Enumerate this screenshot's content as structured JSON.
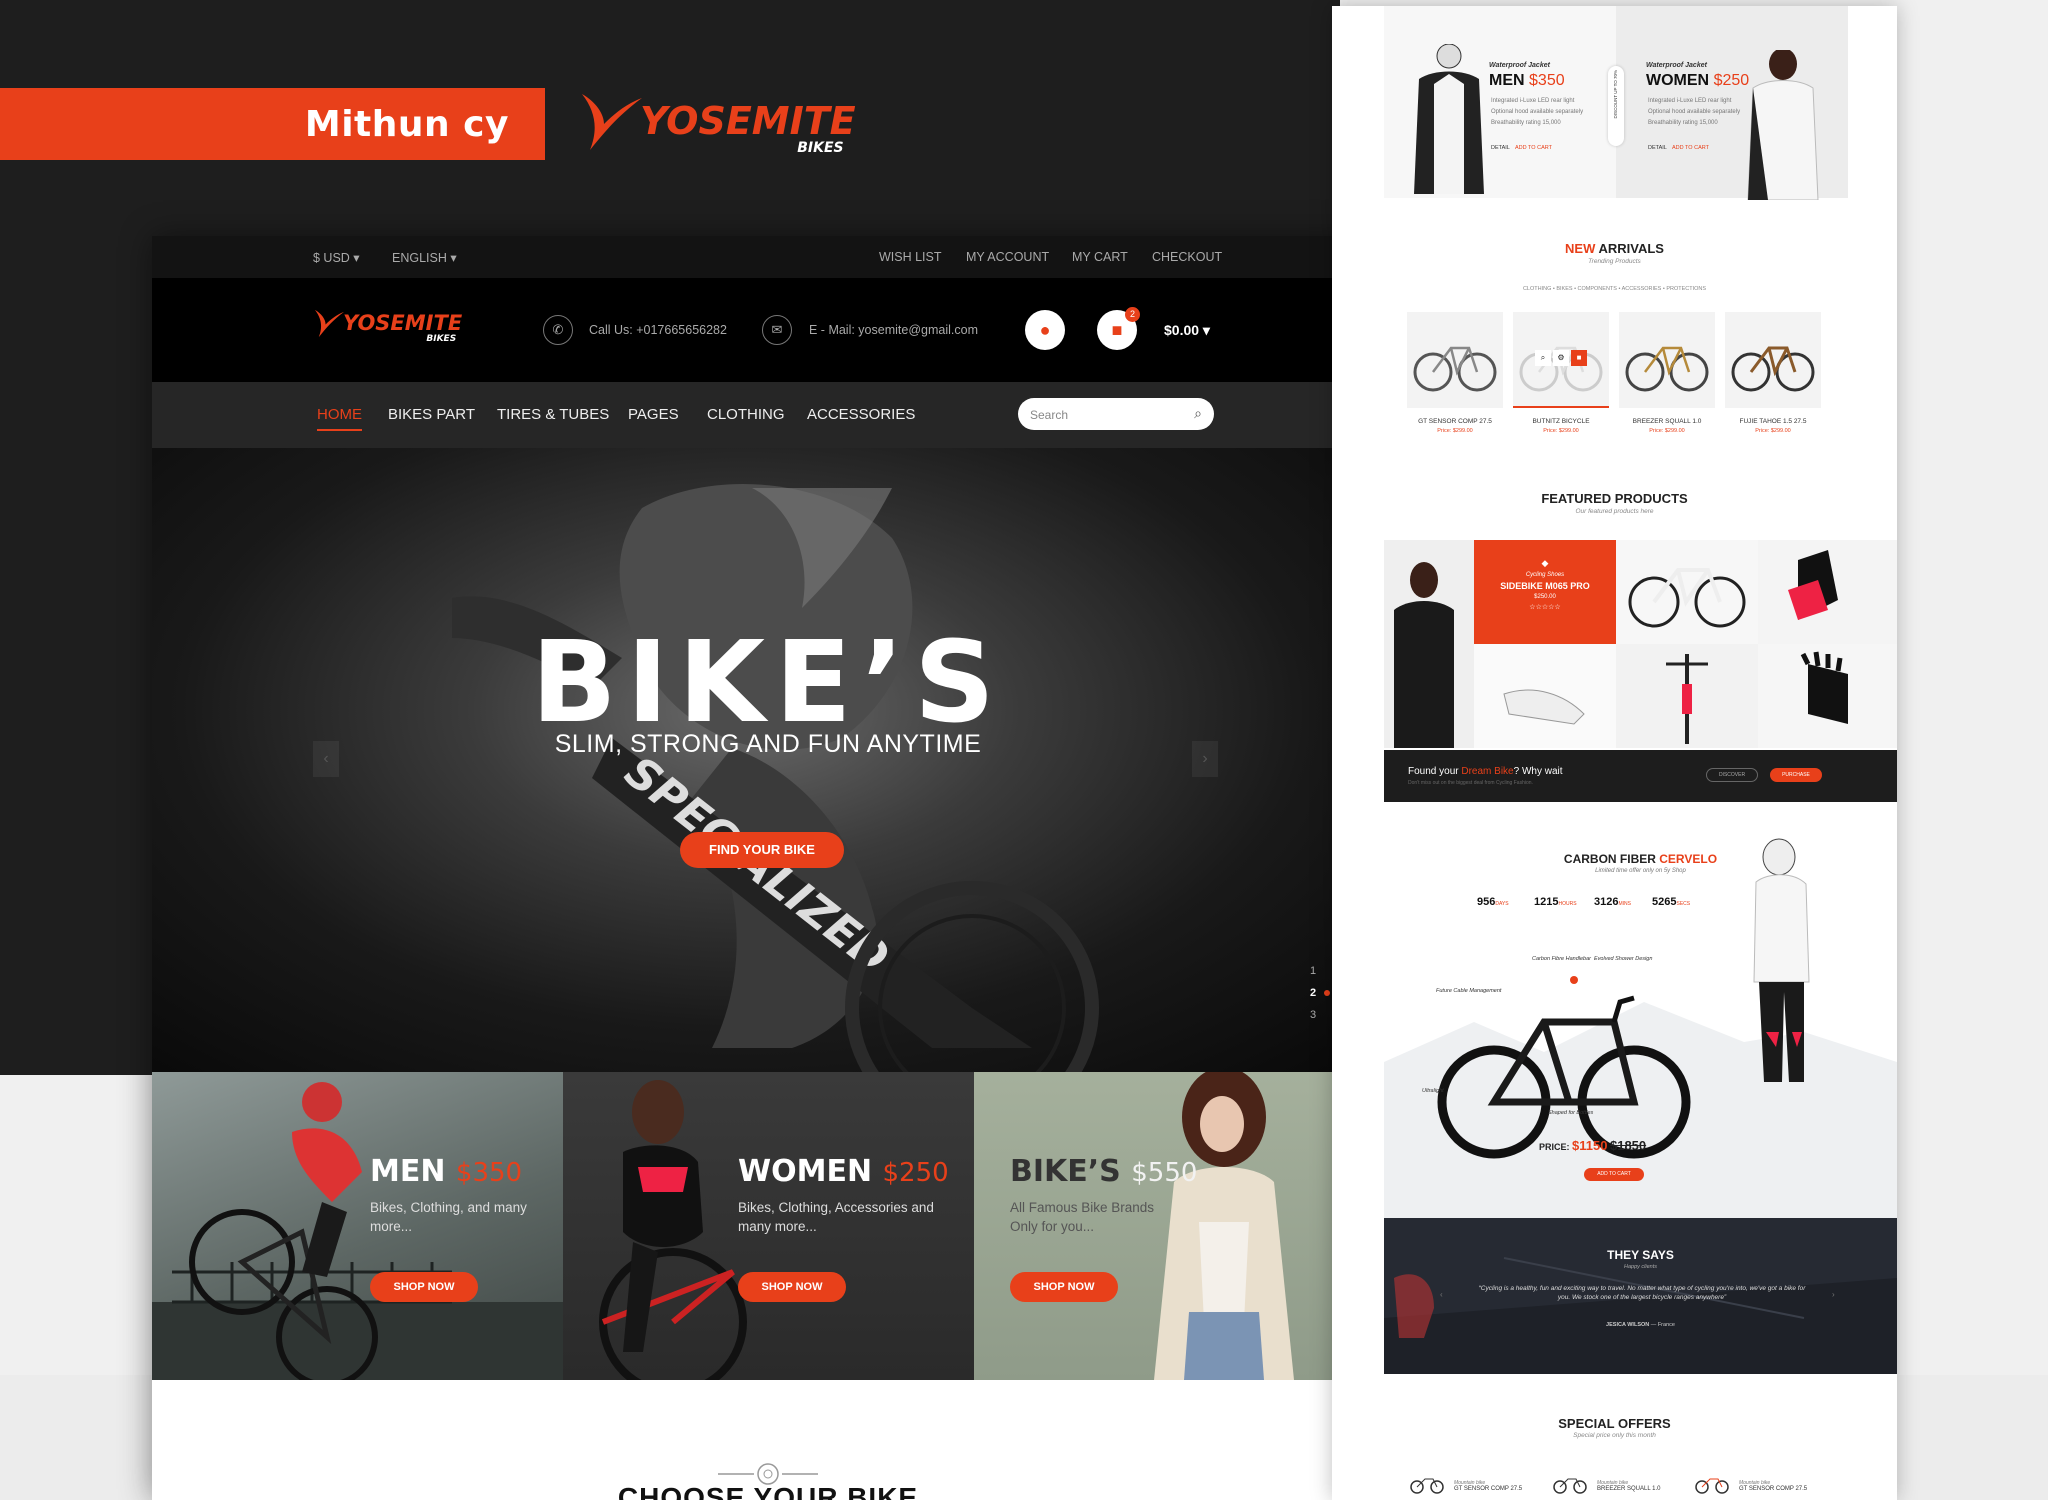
{
  "author": "Mithun cy",
  "brand": {
    "name": "YOSEMITE",
    "sub": "BIKES"
  },
  "topbar": {
    "currency": "$ USD",
    "language": "ENGLISH",
    "links": [
      "WISH LIST",
      "MY ACCOUNT",
      "MY CART",
      "CHECKOUT"
    ]
  },
  "header": {
    "phone": "Call Us: +017665656282",
    "email": "E - Mail: yosemite@gmail.com",
    "cart_count": "2",
    "cart_total": "$0.00"
  },
  "nav": {
    "items": [
      "HOME",
      "BIKES PART",
      "TIRES & TUBES",
      "PAGES",
      "CLOTHING",
      "ACCESSORIES"
    ],
    "active": "HOME",
    "search_placeholder": "Search"
  },
  "hero": {
    "title": "BIKE’S",
    "subtitle": "SLIM, STRONG AND FUN ANYTIME",
    "button": "FIND YOUR BIKE",
    "slides": [
      "1",
      "2",
      "3"
    ],
    "active_slide": "2"
  },
  "promos": [
    {
      "title": "MEN",
      "price": "$350",
      "desc": "Bikes, Clothing, and many more...",
      "button": "SHOP NOW"
    },
    {
      "title": "WOMEN",
      "price": "$250",
      "desc": "Bikes, Clothing, Accessories and many more...",
      "button": "SHOP NOW"
    },
    {
      "title": "BIKE’S",
      "price": "$550",
      "desc": "All Famous Bike Brands Only for you...",
      "button": "SHOP NOW"
    }
  ],
  "choose_title": "CHOOSE YOUR BIKE",
  "right": {
    "jackets": [
      {
        "label": "Waterproof Jacket",
        "title": "MEN",
        "price": "$350",
        "lines": [
          "Integrated i-Luxe LED rear light",
          "Optional hood available separately",
          "Breathability rating 15,000"
        ],
        "detail": "DETAIL",
        "add": "ADD TO CART"
      },
      {
        "label": "Waterproof Jacket",
        "title": "WOMEN",
        "price": "$250",
        "lines": [
          "Integrated i-Luxe LED rear light",
          "Optional hood available separately",
          "Breathability rating 15,000"
        ],
        "detail": "DETAIL",
        "add": "ADD TO CART"
      }
    ],
    "discount": "DISCOUNT UP TO 70%",
    "new_arrivals": {
      "title": "NEW ARRIVALS",
      "sub": "Trending Products",
      "filters": "CLOTHING • BIKES • COMPONENTS • ACCESSORIES • PROTECTIONS",
      "products": [
        {
          "name": "GT SENSOR COMP 27.5",
          "price": "Price: $299.00"
        },
        {
          "name": "BUTNITZ BICYCLE",
          "price": "Price: $299.00"
        },
        {
          "name": "BREEZER SQUALL 1.0",
          "price": "Price: $299.00"
        },
        {
          "name": "FUJIE TAHOE 1.5 27.5",
          "price": "Price: $299.00"
        }
      ]
    },
    "featured": {
      "title": "FEATURED PRODUCTS",
      "sub": "Our featured products here",
      "card_label": "Cycling Shoes",
      "card_name": "SIDEBIKE M065 PRO",
      "card_price": "$250.00",
      "stars": "☆☆☆☆☆"
    },
    "dream": {
      "text_pre": "Found your ",
      "highlight": "Dream Bike",
      "text_post": "? Why wait",
      "sub": "Don't miss out on the biggest deal from Cycling Fashion.",
      "discover": "DISCOVER",
      "purchase": "PURCHASE"
    },
    "carbon": {
      "title": "CARBON FIBER",
      "highlight": "CERVELO",
      "sub": "Limited time offer only on 5y Shop",
      "stats": [
        {
          "v": "956",
          "u": "DAYS"
        },
        {
          "v": "1215",
          "u": "HOURS"
        },
        {
          "v": "3126",
          "u": "MINS"
        },
        {
          "v": "5265",
          "u": "SECS"
        }
      ],
      "callouts": [
        "Carbon Fibre Handlebar",
        "Future Cable Management",
        "Evolved Shower Design",
        "Shaped for Bottles",
        "Ultralight"
      ],
      "price_label": "PRICE:",
      "price": "$1150",
      "old_price": "$1850",
      "button": "ADD TO CART"
    },
    "says": {
      "title": "THEY SAYS",
      "sub": "Happy clients",
      "quote": "“Cycling is a healthy, fun and exciting way to travel. No matter what type of cycling you're into, we've got a bike for you. We stock one of the largest bicycle ranges anywhere”",
      "author": "JESICA WILSON",
      "country": "France"
    },
    "special": {
      "title": "SPECIAL OFFERS",
      "sub": "Special price only this month",
      "items": [
        {
          "label": "Mountain bike",
          "name": "GT SENSOR COMP 27.5"
        },
        {
          "label": "Mountain bike",
          "name": "BREEZER SQUALL 1.0"
        },
        {
          "label": "Mountain bike",
          "name": "GT SENSOR COMP 27.5"
        }
      ]
    }
  },
  "colors": {
    "accent": "#e8401a",
    "dark": "#1e1e1e"
  }
}
